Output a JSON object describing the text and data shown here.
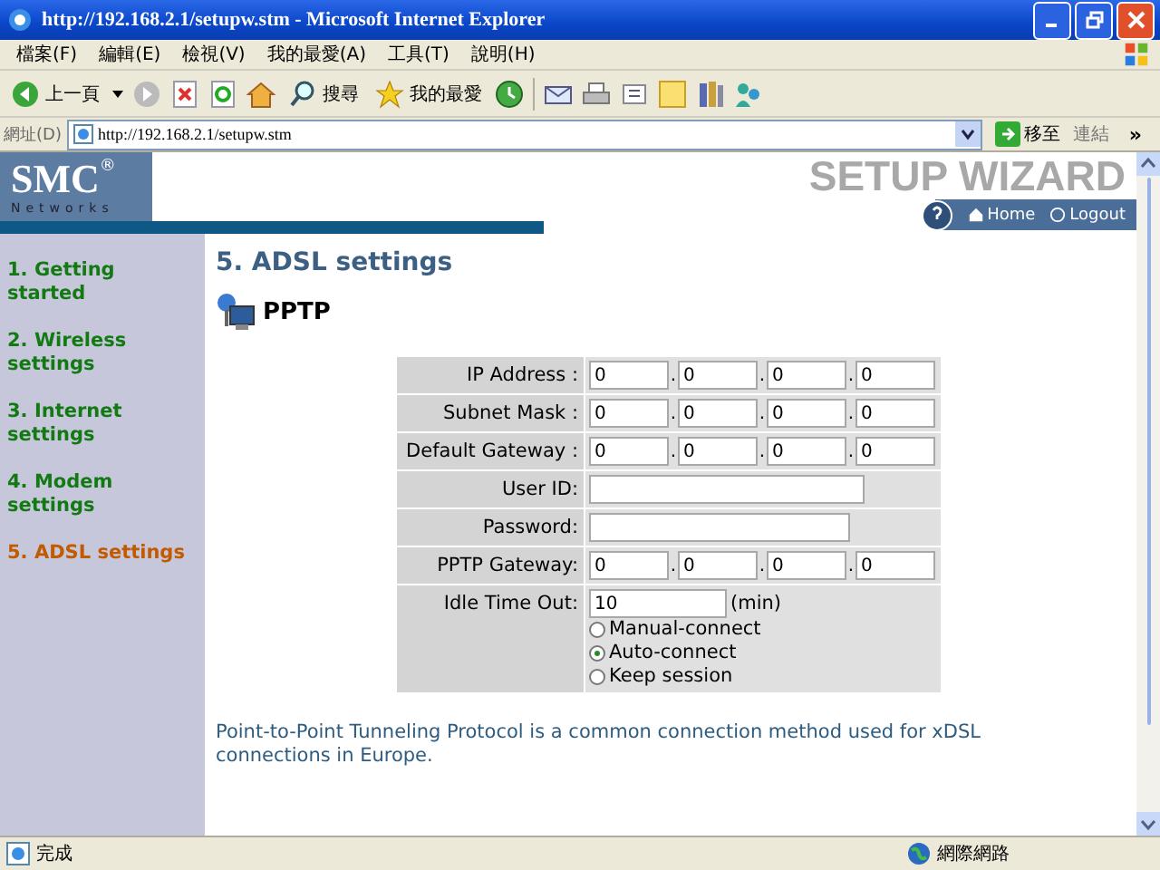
{
  "window": {
    "title": "http://192.168.2.1/setupw.stm - Microsoft Internet Explorer"
  },
  "menu": [
    "檔案(F)",
    "編輯(E)",
    "檢視(V)",
    "我的最愛(A)",
    "工具(T)",
    "說明(H)"
  ],
  "toolbar": {
    "back": "上一頁",
    "search": "搜尋",
    "favorites": "我的最愛"
  },
  "address_bar": {
    "label": "網址(D)",
    "value": "http://192.168.2.1/setupw.stm",
    "go": "移至",
    "links": "連結",
    "more": "»"
  },
  "page": {
    "logo": {
      "name": "SMC",
      "mark": "®",
      "sub": "Networks"
    },
    "banner": "SETUP WIZARD",
    "nav": [
      "Home",
      "Logout"
    ],
    "sidebar": [
      {
        "label": "1. Getting started",
        "selected": false
      },
      {
        "label": "2. Wireless settings",
        "selected": false
      },
      {
        "label": "3. Internet settings",
        "selected": false
      },
      {
        "label": "4. Modem settings",
        "selected": false
      },
      {
        "label": "5. ADSL settings",
        "selected": true
      }
    ],
    "heading": "5. ADSL settings",
    "section": "PPTP",
    "form": [
      {
        "kind": "ip",
        "label": "IP Address :",
        "octets": [
          "0",
          "0",
          "0",
          "0"
        ],
        "separators": [
          ".",
          ".",
          "."
        ]
      },
      {
        "kind": "ip",
        "label": "Subnet Mask :",
        "octets": [
          "0",
          "0",
          "0",
          "0"
        ],
        "separators": [
          ".",
          ".",
          "."
        ]
      },
      {
        "kind": "ip",
        "label": "Default Gateway :",
        "octets": [
          "0",
          "0",
          "0",
          "0"
        ],
        "separators": [
          ".",
          ".",
          "."
        ]
      },
      {
        "kind": "text",
        "label": "User ID:"
      },
      {
        "kind": "text",
        "label": "Password:"
      },
      {
        "kind": "ip",
        "label": "PPTP Gateway:",
        "octets": [
          "0",
          "0",
          "0",
          "0"
        ],
        "separators": [
          ".",
          ".",
          "."
        ]
      },
      {
        "kind": "idle",
        "label": "Idle Time Out:",
        "value": "10",
        "unit": "(min)",
        "options": [
          {
            "label": "Manual-connect",
            "selected": false
          },
          {
            "label": "Auto-connect",
            "selected": true
          },
          {
            "label": "Keep session",
            "selected": false
          }
        ]
      }
    ],
    "description": "Point-to-Point Tunneling Protocol is a common connection method used for xDSL connections in Europe."
  },
  "status_bar": {
    "text": "完成",
    "zone": "網際網路"
  }
}
